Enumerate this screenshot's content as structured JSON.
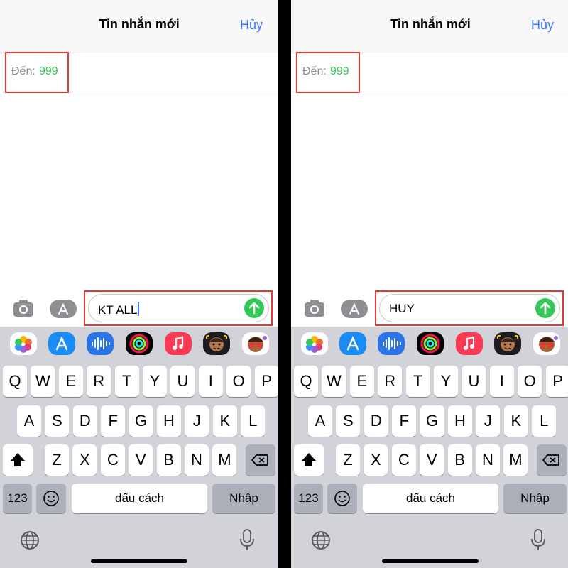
{
  "header": {
    "title": "Tin nhắn mới",
    "cancel": "Hủy"
  },
  "recipient": {
    "label": "Đến:",
    "value": "999"
  },
  "screens": [
    {
      "message_text": "KT ALL",
      "cursor_visible": true
    },
    {
      "message_text": "HUY",
      "cursor_visible": false
    }
  ],
  "app_strip": [
    "photos-icon",
    "app-store-icon",
    "audio-message-icon",
    "activity-icon",
    "music-icon",
    "memoji-icon",
    "memoji-stickers-icon"
  ],
  "keyboard": {
    "row1": [
      "Q",
      "W",
      "E",
      "R",
      "T",
      "Y",
      "U",
      "I",
      "O",
      "P"
    ],
    "row2": [
      "A",
      "S",
      "D",
      "F",
      "G",
      "H",
      "J",
      "K",
      "L"
    ],
    "row3": [
      "Z",
      "X",
      "C",
      "V",
      "B",
      "N",
      "M"
    ],
    "numbers_label": "123",
    "space_label": "dấu cách",
    "return_label": "Nhập"
  },
  "colors": {
    "accent_blue": "#3478f6",
    "recipient_green": "#34c759",
    "highlight_red": "#e53935",
    "send_green": "#34c759"
  }
}
